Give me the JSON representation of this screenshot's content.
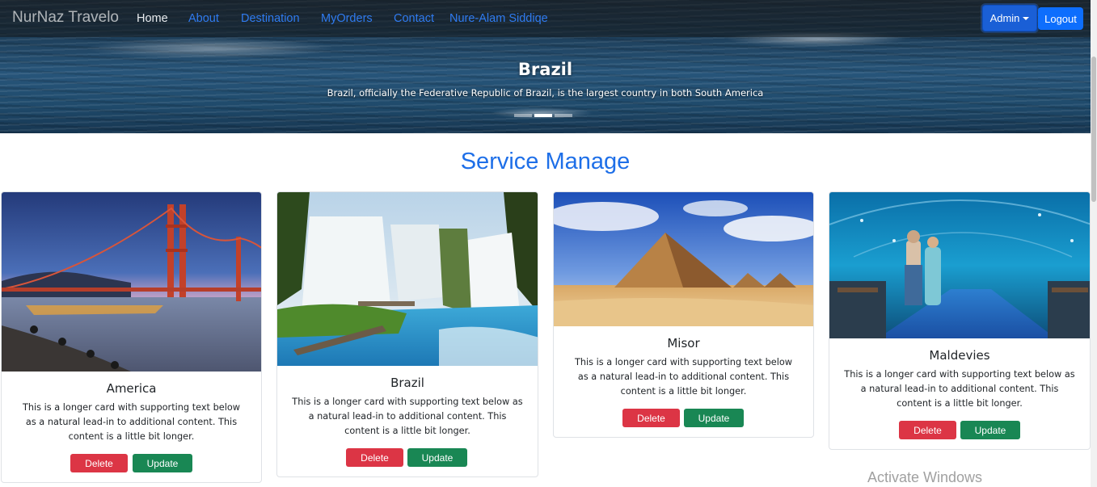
{
  "navbar": {
    "brand": "NurNaz Travelo",
    "links": [
      "Home",
      "About",
      "Destination",
      "MyOrders",
      "Contact",
      "Nure-Alam Siddiqe"
    ],
    "admin_label": "Admin",
    "logout_label": "Logout"
  },
  "hero": {
    "title": "Brazil",
    "text": "Brazil, officially the Federative Republic of Brazil, is the largest country in both South America",
    "slide_count": 3,
    "active_slide": 1
  },
  "main": {
    "title": "Service Manage"
  },
  "cards": [
    {
      "title": "America",
      "text": "This is a longer card with supporting text below as a natural lead-in to additional content. This content is a little bit longer.",
      "delete_label": "Delete",
      "update_label": "Update",
      "image": "golden-gate-bridge-photo"
    },
    {
      "title": "Brazil",
      "text": "This is a longer card with supporting text below as a natural lead-in to additional content. This content is a little bit longer.",
      "delete_label": "Delete",
      "update_label": "Update",
      "image": "waterfall-photo"
    },
    {
      "title": "Misor",
      "text": "This is a longer card with supporting text below as a natural lead-in to additional content. This content is a little bit longer.",
      "delete_label": "Delete",
      "update_label": "Update",
      "image": "pyramid-photo"
    },
    {
      "title": "Maldevies",
      "text": "This is a longer card with supporting text below as a natural lead-in to additional content. This content is a little bit longer.",
      "delete_label": "Delete",
      "update_label": "Update",
      "image": "underwater-tunnel-photo"
    }
  ],
  "watermark": "Activate Windows",
  "colors": {
    "accent": "#1e6fe8",
    "delete": "#dc3545",
    "update": "#198754",
    "primary": "#0d6efd"
  }
}
